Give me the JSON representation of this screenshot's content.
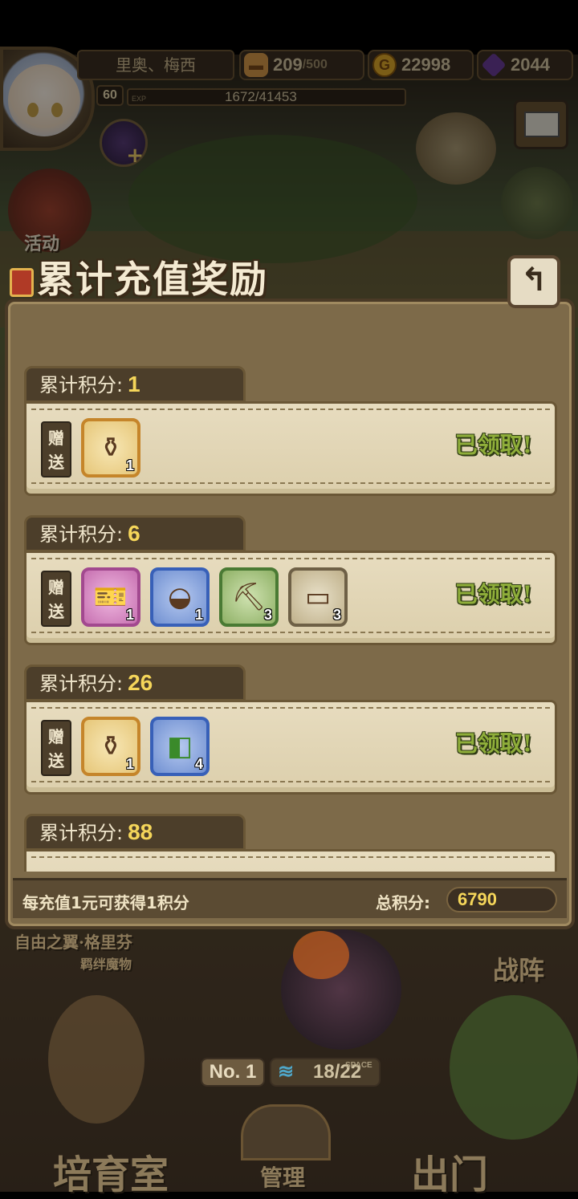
{
  "hud": {
    "player_name": "里奥、梅西",
    "level": "60",
    "exp_tag": "EXP",
    "exp_value": "1672/41453",
    "stamina": {
      "current": "209",
      "max": "/500",
      "icon": "bread-icon"
    },
    "gold": {
      "value": "22998",
      "icon": "gold-coin-icon"
    },
    "gems": {
      "value": "2044",
      "icon": "purple-gem-icon"
    }
  },
  "side_buttons": {
    "event_label": "活动"
  },
  "modal": {
    "title": "累计充值奖励",
    "back_icon": "back-arrow-icon",
    "tab_prefix": "累计积分:",
    "gift_label": "赠送",
    "tiers": [
      {
        "points": "1",
        "status": "已领取!",
        "items": [
          {
            "icon": "winged-potion-icon",
            "count": "1",
            "rarity": "gold"
          }
        ]
      },
      {
        "points": "6",
        "status": "已领取!",
        "items": [
          {
            "icon": "ticket-icon",
            "count": "1",
            "rarity": "purple"
          },
          {
            "icon": "egg-helmet-icon",
            "count": "1",
            "rarity": "blue"
          },
          {
            "icon": "pickaxe-icon",
            "count": "3",
            "rarity": "green"
          },
          {
            "icon": "treasure-chest-icon",
            "count": "3",
            "rarity": "plain"
          }
        ]
      },
      {
        "points": "26",
        "status": "已领取!",
        "items": [
          {
            "icon": "winged-potion-icon",
            "count": "1",
            "rarity": "gold"
          },
          {
            "icon": "green-jar-icon",
            "count": "4",
            "rarity": "blue"
          }
        ]
      },
      {
        "points": "88",
        "status": "",
        "items": []
      }
    ],
    "footer": {
      "rule": "每充值1元可获得1积分",
      "total_label": "总积分:",
      "total_value": "6790"
    }
  },
  "background": {
    "bond_name": "自由之翼·格里芬",
    "bond_sub": "羁绊魔物",
    "formation_label": "战阵",
    "rank_label": "No. 1",
    "space_label": "SPACE",
    "space_value": "18/22",
    "nursery_label": "培育室",
    "manage_label": "管理",
    "go_out_label": "出门"
  }
}
